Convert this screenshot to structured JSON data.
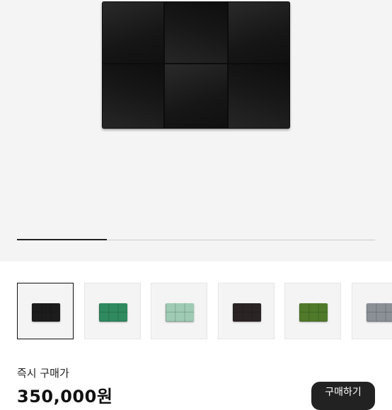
{
  "product_image": {
    "alt": "intrecciato card case",
    "carousel_progress": 0.25
  },
  "thumbnails": [
    {
      "color": "#1c1c1c",
      "selected": true
    },
    {
      "color": "#2f8a5f",
      "selected": false
    },
    {
      "color": "#9fcbb4",
      "selected": false
    },
    {
      "color": "#2b2424",
      "selected": false
    },
    {
      "color": "#4f7a2a",
      "selected": false
    },
    {
      "color": "#8a9096",
      "selected": false
    }
  ],
  "purchase": {
    "label": "즉시 구매가",
    "price": "350,000원",
    "button_label": "구매하기"
  }
}
